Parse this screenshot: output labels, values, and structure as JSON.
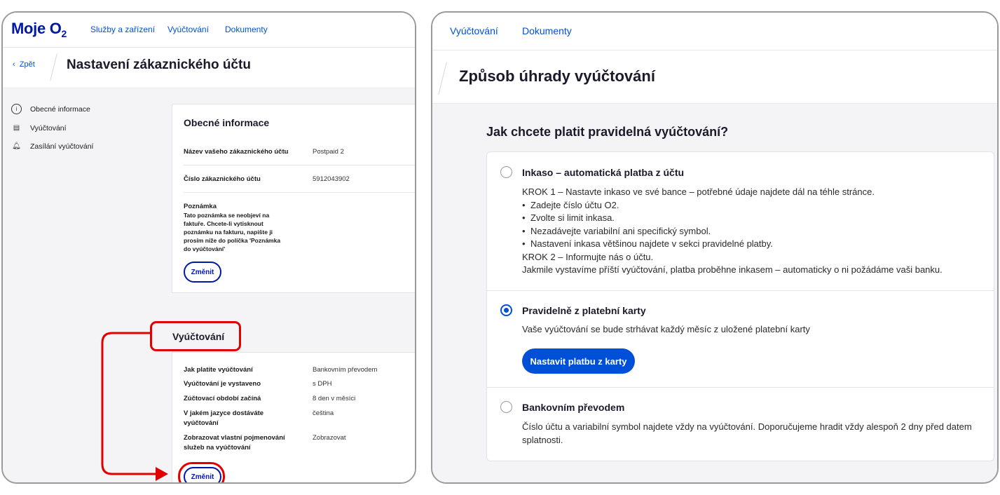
{
  "left": {
    "logo": "Moje O",
    "logo_sub": "2",
    "nav": [
      "Služby a zařízení",
      "Vyúčtování",
      "Dokumenty"
    ],
    "back": "Zpět",
    "title": "Nastavení zákaznického účtu",
    "sidebar": [
      {
        "icon": "info-icon",
        "label": "Obecné informace"
      },
      {
        "icon": "billing-icon",
        "label": "Vyúčtování"
      },
      {
        "icon": "bell-icon",
        "label": "Zasílání vyúčtování"
      }
    ],
    "general": {
      "title": "Obecné informace",
      "rows": [
        {
          "k": "Název vašeho zákaznického účtu",
          "v": "Postpaid 2"
        },
        {
          "k": "Číslo zákaznického účtu",
          "v": "5912043902"
        }
      ],
      "note_title": "Poznámka",
      "note_text": "Tato poznámka se neobjeví na faktuře. Chcete-li vytisknout poznámku na fakturu, napište ji prosím níže do políčka 'Poznámka do vyúčtování'",
      "button": "Změnit"
    },
    "billing": {
      "title": "Vyúčtování",
      "rows": [
        {
          "k": "Jak platíte vyúčtování",
          "v": "Bankovním převodem"
        },
        {
          "k": "Vyúčtování je vystaveno",
          "v": "s DPH"
        },
        {
          "k": "Zúčtovací období začíná",
          "v": "8 den v měsíci"
        },
        {
          "k": "V jakém jazyce dostáváte vyúčtování",
          "v": "čeština"
        },
        {
          "k": "Zobrazovat vlastní pojmenování služeb na vyúčtování",
          "v": "Zobrazovat"
        }
      ],
      "button": "Změnit"
    }
  },
  "right": {
    "nav": [
      "Vyúčtování",
      "Dokumenty"
    ],
    "title": "Způsob úhrady vyúčtování",
    "question": "Jak chcete platit pravidelná vyúčtování?",
    "options": [
      {
        "label": "Inkaso – automatická platba z účtu",
        "selected": false,
        "step1": "KROK 1 – Nastavte inkaso ve své bance – potřebné údaje najdete dál na téhle stránce.",
        "bullets": [
          "Zadejte číslo účtu O2.",
          "Zvolte si limit inkasa.",
          "Nezadávejte variabilní ani specifický symbol.",
          "Nastavení inkasa většinou najdete v sekci pravidelné platby."
        ],
        "step2": "KROK 2 – Informujte nás o účtu.",
        "step2_text": "Jakmile vystavíme příští vyúčtování, platba proběhne inkasem – automaticky o ni požádáme vaši banku."
      },
      {
        "label": "Pravidelně z platební karty",
        "selected": true,
        "text": "Vaše vyúčtování se bude strhávat každý měsíc z uložené platební karty",
        "button": "Nastavit platbu z karty"
      },
      {
        "label": "Bankovním převodem",
        "selected": false,
        "text": "Číslo účtu a variabilní symbol najdete vždy na vyúčtování. Doporučujeme hradit vždy alespoň 2 dny před datem splatnosti."
      }
    ]
  },
  "colors": {
    "brand": "#0019a5",
    "link": "#0050d7",
    "highlight": "#e10000"
  }
}
